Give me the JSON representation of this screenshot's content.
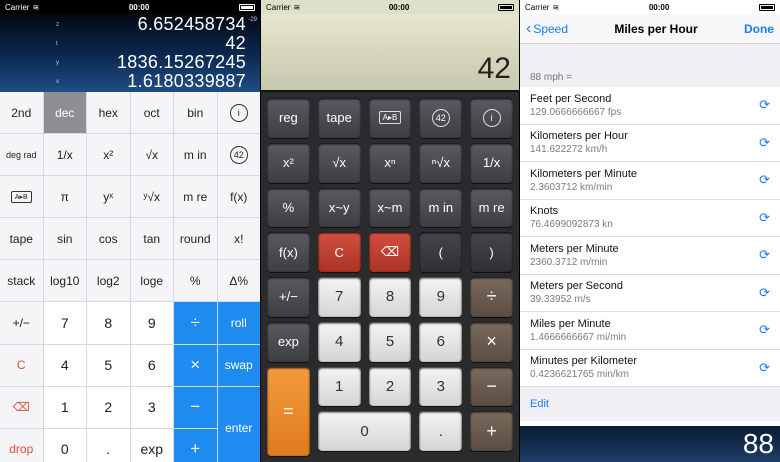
{
  "status": {
    "carrier": "Carrier",
    "time": "00:00"
  },
  "panel1": {
    "stack": [
      {
        "index": "z",
        "value": "6.652458734"
      },
      {
        "index": "t",
        "value": "42"
      },
      {
        "index": "y",
        "value": "1836.15267245"
      },
      {
        "index": "x",
        "value": "1.6180339887"
      }
    ],
    "exponent": "-29",
    "keys": [
      "2nd",
      "dec",
      "hex",
      "oct",
      "bin",
      "i",
      "deg rad",
      "1/x",
      "x²",
      "√x",
      "m in",
      "42",
      "A▸B",
      "π",
      "yˣ",
      "ʸ√x",
      "m re",
      "f(x)",
      "tape",
      "sin",
      "cos",
      "tan",
      "round",
      "x!",
      "stack",
      "log10",
      "log2",
      "loge",
      "%",
      "Δ%",
      "+/−",
      "7",
      "8",
      "9",
      "÷",
      "roll",
      "C",
      "4",
      "5",
      "6",
      "×",
      "swap",
      "⌫",
      "1",
      "2",
      "3",
      "−",
      "enter",
      "drop",
      "0",
      ".",
      "exp",
      "+"
    ]
  },
  "panel2": {
    "display": "42",
    "keys": [
      "reg",
      "tape",
      "A▸B",
      "42",
      "i",
      "x²",
      "√x",
      "xⁿ",
      "ⁿ√x",
      "1/x",
      "%",
      "x~y",
      "x~m",
      "m in",
      "m re",
      "f(x)",
      "C",
      "⌫",
      "(",
      ")",
      "+/−",
      "7",
      "8",
      "9",
      "÷",
      "exp",
      "4",
      "5",
      "6",
      "×",
      "=",
      "1",
      "2",
      "3",
      "−",
      "0",
      ".",
      "+"
    ]
  },
  "panel3": {
    "back": "Speed",
    "title": "Miles per Hour",
    "done": "Done",
    "header": "88 mph =",
    "items": [
      {
        "title": "Feet per Second",
        "value": "129.0666666667 fps"
      },
      {
        "title": "Kilometers per Hour",
        "value": "141.622272 km/h"
      },
      {
        "title": "Kilometers per Minute",
        "value": "2.3603712 km/min"
      },
      {
        "title": "Knots",
        "value": "76.4699092873 kn"
      },
      {
        "title": "Meters per Minute",
        "value": "2360.3712 m/min"
      },
      {
        "title": "Meters per Second",
        "value": "39.33952 m/s"
      },
      {
        "title": "Miles per Minute",
        "value": "1.4666666667 mi/min"
      },
      {
        "title": "Minutes per Kilometer",
        "value": "0.4236621765 min/km"
      }
    ],
    "edit": "Edit",
    "display": "88"
  }
}
